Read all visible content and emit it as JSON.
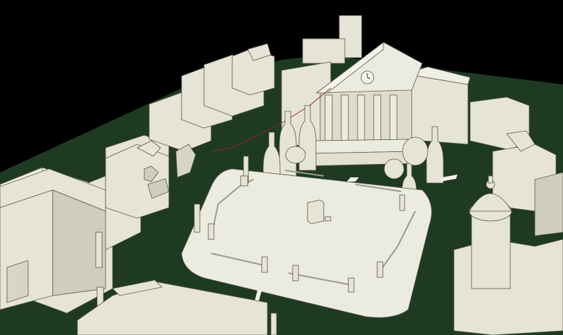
{
  "scene": {
    "colors": {
      "background": "#000000",
      "ground": "#1e3a23",
      "model": "#e6e4d6",
      "model_shadow": "#b8b6a8",
      "model_dark": "#9c9a8e",
      "outline": "#555548",
      "wire": "#8b2a2a",
      "plaza": "#ecebdf",
      "road_marking": "#f2f2ea"
    },
    "clock_icon": "clock-icon"
  }
}
